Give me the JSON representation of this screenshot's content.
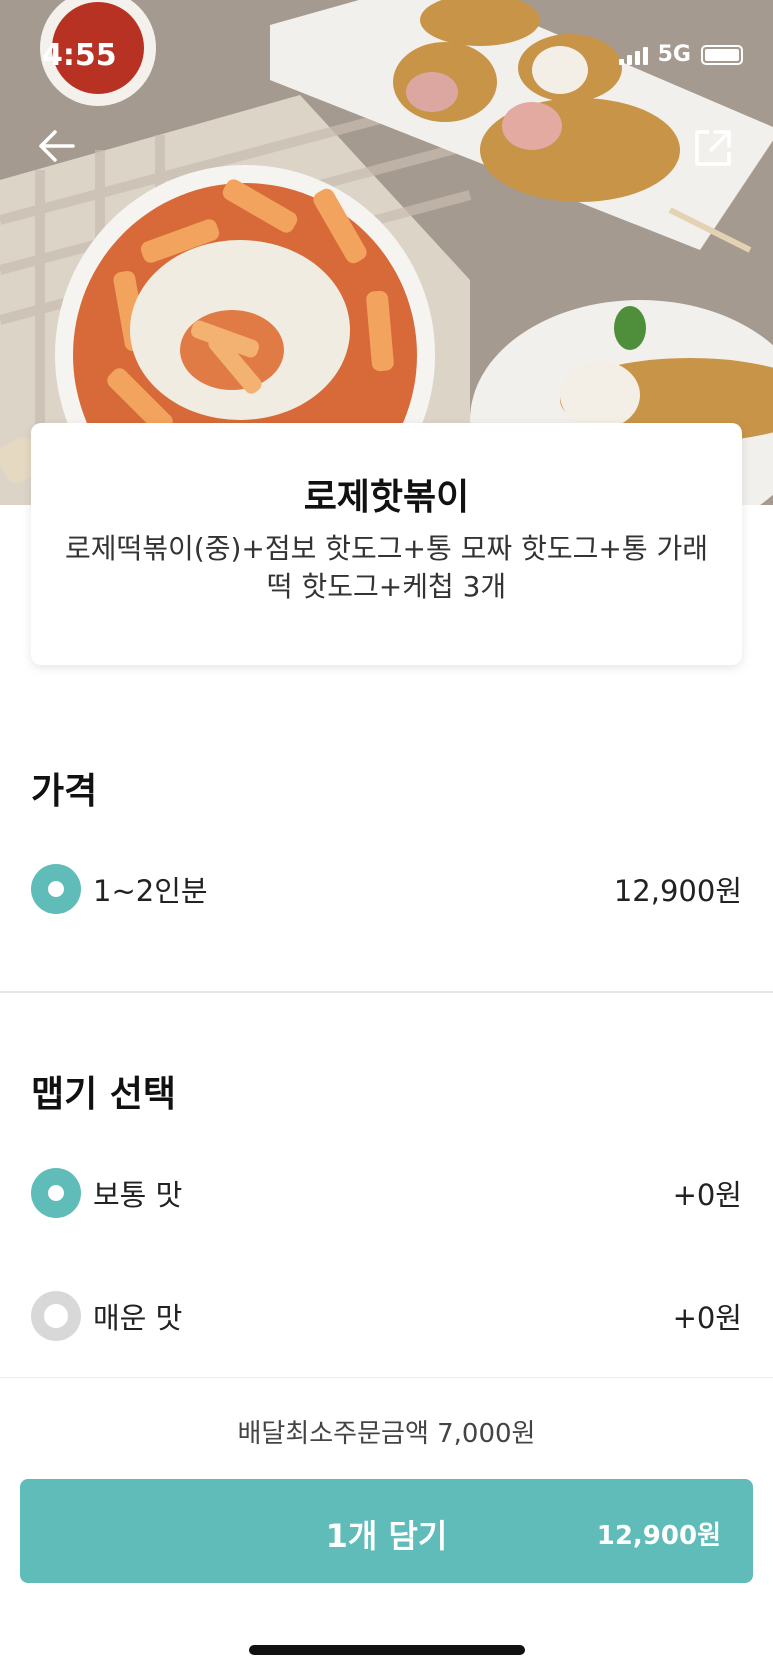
{
  "status_bar": {
    "time": "4:55",
    "network": "5G"
  },
  "hero": {
    "back_icon": "arrow-left-icon",
    "share_icon": "share-icon"
  },
  "menu": {
    "name": "로제핫볶이",
    "description": "로제떡볶이(중)+점보 핫도그+통 모짜 핫도그+통 가래떡 핫도그+케첩 3개"
  },
  "price_section": {
    "title": "가격",
    "options": [
      {
        "label": "1~2인분",
        "price": "12,900원",
        "selected": true
      }
    ]
  },
  "spicy_section": {
    "title": "맵기 선택",
    "options": [
      {
        "label": "보통 맛",
        "price": "+0원",
        "selected": true
      },
      {
        "label": "매운 맛",
        "price": "+0원",
        "selected": false
      }
    ]
  },
  "footer": {
    "min_order": "배달최소주문금액 7,000원",
    "cart_label": "1개 담기",
    "cart_price": "12,900원"
  },
  "colors": {
    "accent": "#5fbcb9",
    "radio_off": "#d8d8d8"
  }
}
